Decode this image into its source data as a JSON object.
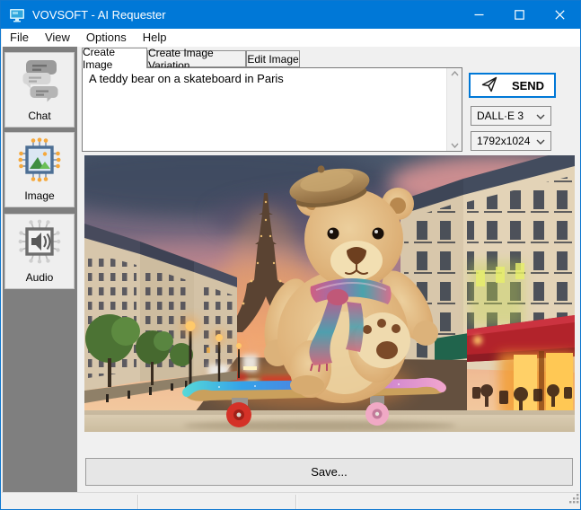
{
  "window": {
    "title": "VOVSOFT - AI Requester"
  },
  "menu": {
    "items": [
      "File",
      "View",
      "Options",
      "Help"
    ]
  },
  "sidebar": {
    "items": [
      {
        "label": "Chat",
        "icon": "chat-bubbles-icon"
      },
      {
        "label": "Image",
        "icon": "image-ai-chip-icon"
      },
      {
        "label": "Audio",
        "icon": "audio-ai-chip-icon"
      }
    ]
  },
  "tabs": [
    {
      "label": "Create Image",
      "active": true
    },
    {
      "label": "Create Image Variation",
      "active": false
    },
    {
      "label": "Edit Image",
      "active": false
    }
  ],
  "prompt": {
    "value": "A teddy bear on a skateboard in Paris"
  },
  "controls": {
    "send_label": "SEND",
    "model_selected": "DALL·E 3",
    "size_selected": "1792x1024",
    "save_label": "Save..."
  },
  "result_image": {
    "description": "AI-generated photo: fluffy teddy bear wearing a hat and colorful scarf riding a glittery skateboard on a Paris street with the Eiffel Tower at sunset"
  },
  "colors": {
    "titlebar": "#0078d7",
    "accent": "#0078d7",
    "sidebar_bg": "#7f7f7f"
  }
}
